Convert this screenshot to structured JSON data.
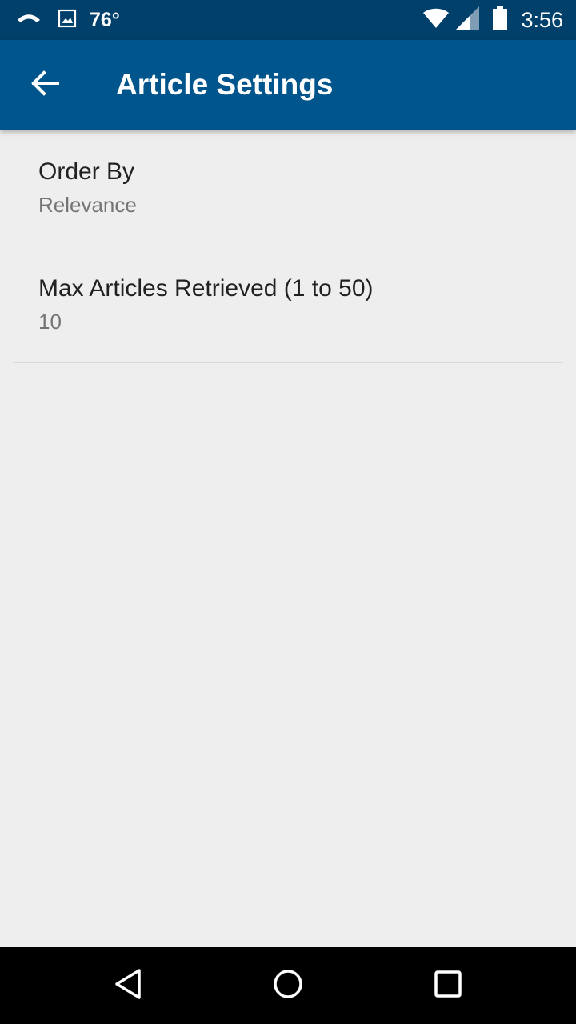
{
  "status_bar": {
    "temperature": "76°",
    "time": "3:56",
    "icons": [
      "missed-call-icon",
      "image-icon",
      "wifi-icon",
      "cell-signal-icon",
      "battery-icon"
    ]
  },
  "app_bar": {
    "title": "Article Settings",
    "back_icon": "arrow-back-icon",
    "color": "#00558c",
    "status_color": "#00406b"
  },
  "preferences": [
    {
      "title": "Order By",
      "summary": "Relevance"
    },
    {
      "title": "Max Articles Retrieved (1 to 50)",
      "summary": "10"
    }
  ],
  "nav_bar": {
    "icons": [
      "back-triangle-icon",
      "home-circle-icon",
      "recents-square-icon"
    ]
  }
}
